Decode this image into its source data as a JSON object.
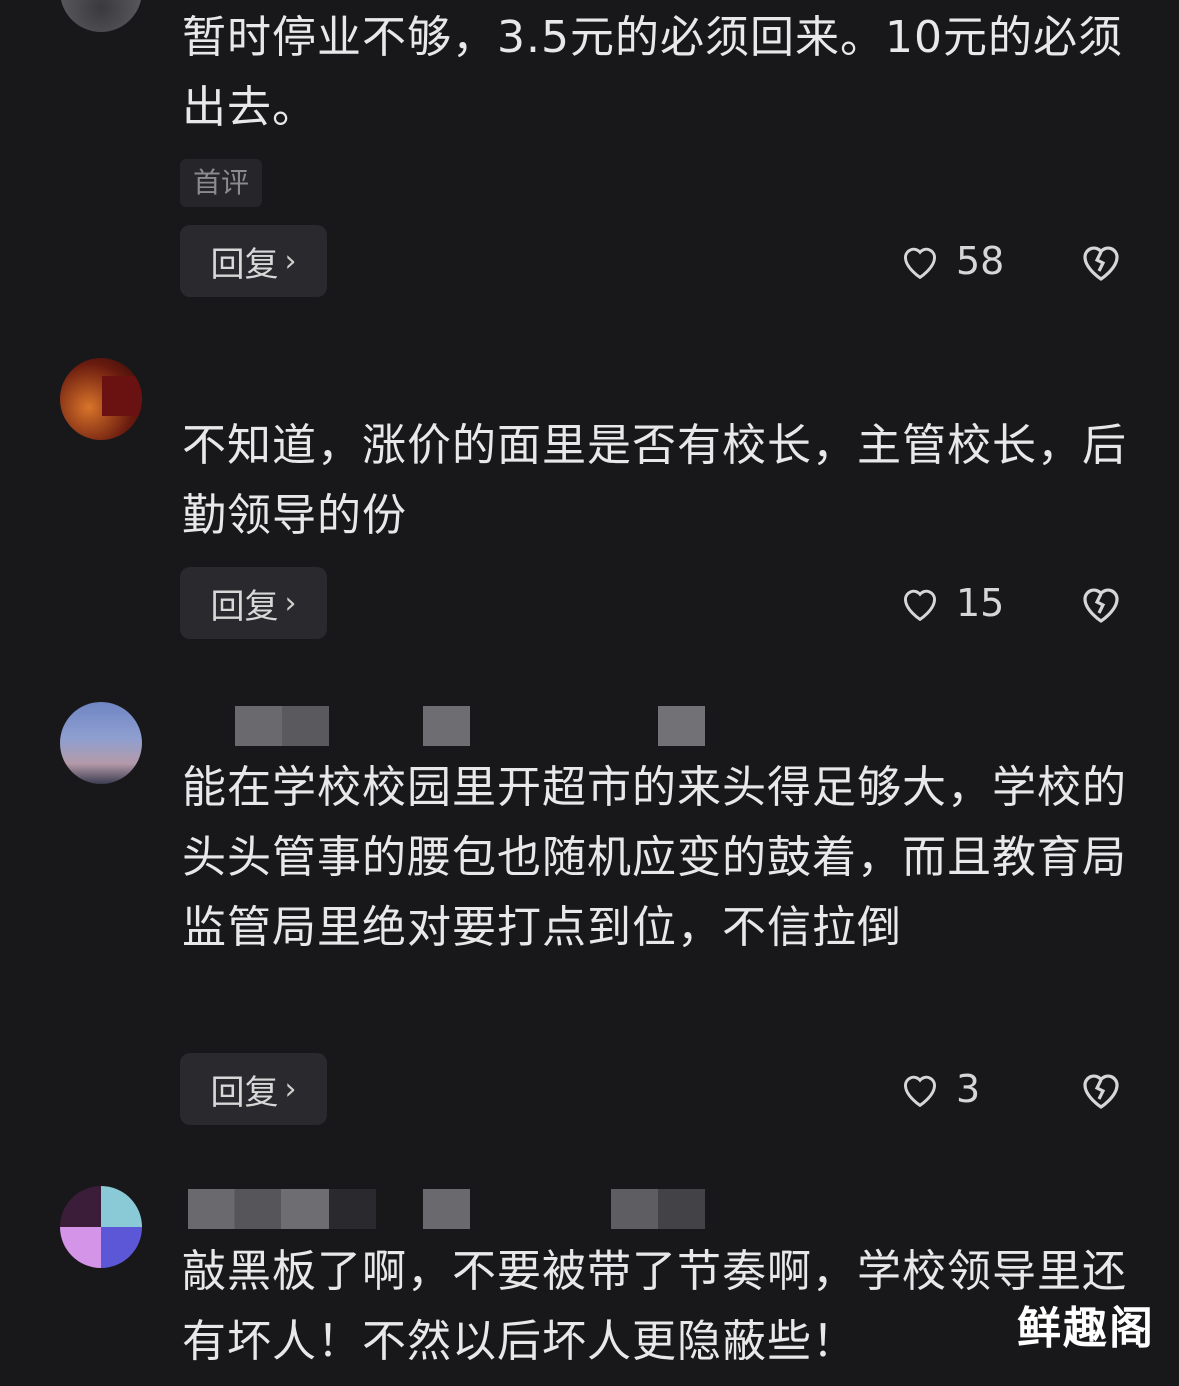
{
  "comments": [
    {
      "text": "暂时停业不够，3.5元的必须回来。10元的必须出去。",
      "tag": "首评",
      "reply_label": "回复",
      "likes": "58"
    },
    {
      "text": "不知道，涨价的面里是否有校长，主管校长，后勤领导的份",
      "reply_label": "回复",
      "likes": "15"
    },
    {
      "text": "能在学校校园里开超市的来头得足够大，学校的头头管事的腰包也随机应变的鼓着，而且教育局监管局里绝对要打点到位，不信拉倒",
      "reply_label": "回复",
      "likes": "3"
    },
    {
      "text": "敲黑板了啊，不要被带了节奏啊，学校领导里还有坏人！不然以后坏人更隐蔽些！"
    }
  ],
  "watermark": "鲜趣阁",
  "icons": {
    "like": "heart-outline-icon",
    "dislike": "broken-heart-icon",
    "chevron": "chevron-right-icon"
  },
  "colors": {
    "background": "#18181b",
    "text": "#e8e8e8",
    "button_bg": "#2a2a2e"
  }
}
